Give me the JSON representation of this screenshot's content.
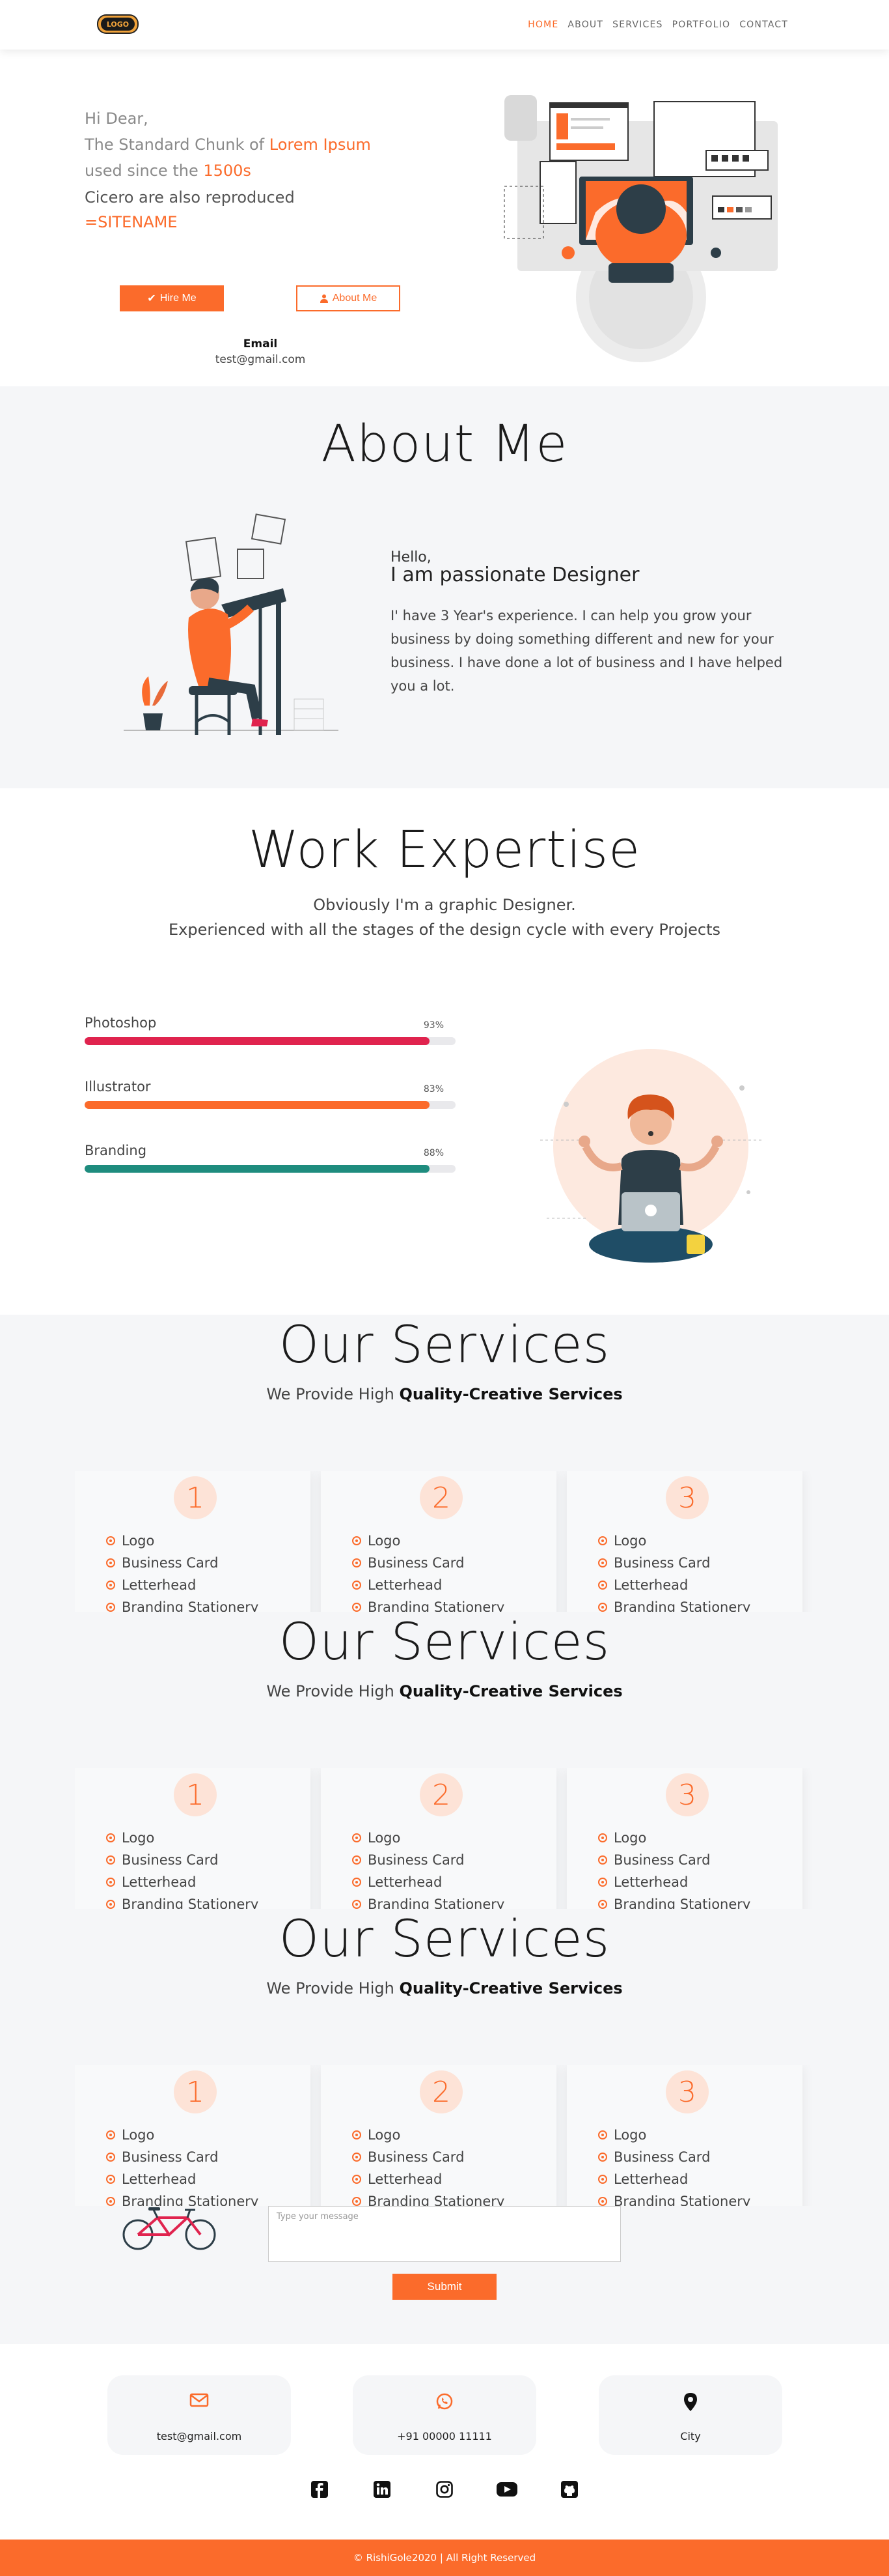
{
  "nav": {
    "logo_text": "LOGO",
    "items": [
      {
        "label": "HOME",
        "active": true
      },
      {
        "label": "ABOUT",
        "active": false
      },
      {
        "label": "SERVICES",
        "active": false
      },
      {
        "label": "PORTFOLIO",
        "active": false
      },
      {
        "label": "CONTACT",
        "active": false
      }
    ]
  },
  "hero": {
    "line1": "Hi Dear,",
    "line2_prefix": "The Standard Chunk of ",
    "line2_highlight": "Lorem Ipsum",
    "line3_prefix": "used since the ",
    "line3_highlight": "1500s",
    "line4": "Cicero are also reproduced",
    "line5": "=SITENAME",
    "hire_label": "Hire Me",
    "about_label": "About Me",
    "email_label": "Email",
    "email": "test@gmail.com"
  },
  "about": {
    "title": "About Me",
    "hello": "Hello,",
    "heading": "I am passionate Designer",
    "body": "I' have 3 Year's experience. I can help you grow your business by doing something different and new for your business. I have done a lot of business and I have helped you a lot."
  },
  "work": {
    "title": "Work Expertise",
    "sub1": "Obviously I'm a graphic Designer.",
    "sub2": "Experienced with all the stages of the design cycle with every Projects",
    "skills": [
      {
        "name": "Photoshop",
        "pct_label": "93%",
        "value": 0.93,
        "color": "#e0234e"
      },
      {
        "name": "Illustrator",
        "pct_label": "83%",
        "value": 0.93,
        "color": "#fb6b2b"
      },
      {
        "name": "Branding",
        "pct_label": "88%",
        "value": 0.93,
        "color": "#1e8c7e"
      }
    ]
  },
  "services": {
    "title": "Our Services",
    "sub_prefix": "We Provide High ",
    "sub_bold": "Quality-Creative Services",
    "cards": [
      {
        "num": "1",
        "items": [
          "Logo",
          "Business Card",
          "Letterhead",
          "Branding Stationery"
        ]
      },
      {
        "num": "2",
        "items": [
          "Logo",
          "Business Card",
          "Letterhead",
          "Branding Stationery"
        ]
      },
      {
        "num": "3",
        "items": [
          "Logo",
          "Business Card",
          "Letterhead",
          "Branding Stationery"
        ]
      }
    ]
  },
  "form": {
    "placeholder": "Type your message",
    "submit_label": "Submit"
  },
  "contact": {
    "email": "test@gmail.com",
    "phone": "+91 00000 11111",
    "city": "City",
    "email_icon": "envelope-icon",
    "phone_icon": "whatsapp-icon",
    "city_icon": "map-pin-icon"
  },
  "social": [
    "facebook-icon",
    "linkedin-icon",
    "instagram-icon",
    "youtube-icon",
    "github-icon"
  ],
  "footer": {
    "text": "© RishiGole2020 | All Right Reserved"
  },
  "colors": {
    "accent": "#fb6b2b",
    "section_bg": "#f5f6f8"
  }
}
